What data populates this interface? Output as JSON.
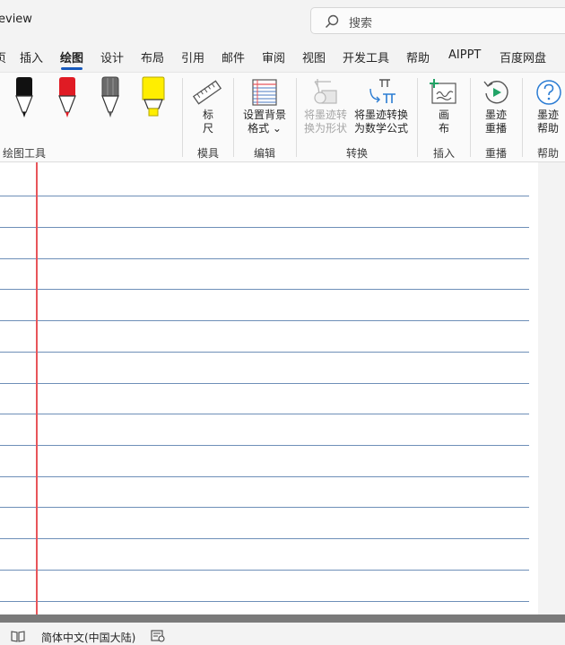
{
  "window": {
    "title_fragment": "eview"
  },
  "search": {
    "placeholder": "搜索"
  },
  "tabs": [
    {
      "label": "页"
    },
    {
      "label": "插入"
    },
    {
      "label": "绘图",
      "active": true
    },
    {
      "label": "设计"
    },
    {
      "label": "布局"
    },
    {
      "label": "引用"
    },
    {
      "label": "邮件"
    },
    {
      "label": "审阅"
    },
    {
      "label": "视图"
    },
    {
      "label": "开发工具"
    },
    {
      "label": "帮助"
    },
    {
      "label": "AIPPT"
    },
    {
      "label": "百度网盘"
    }
  ],
  "ribbon": {
    "pens": [
      {
        "name": "black-pen",
        "color": "#111111"
      },
      {
        "name": "red-pen",
        "color": "#e01b24"
      },
      {
        "name": "pencil",
        "color": "#6b6b6b"
      },
      {
        "name": "highlighter",
        "color": "#ffee00"
      }
    ],
    "groups": {
      "drawing_tools": "绘图工具",
      "stencils": "模具",
      "edit": "编辑",
      "convert": "转换",
      "insert": "插入",
      "replay": "重播",
      "help": "帮助"
    },
    "buttons": {
      "ruler": {
        "line1": "标",
        "line2": "尺"
      },
      "bg_format": {
        "line1": "设置背景",
        "line2": "格式 ⌄"
      },
      "ink_to_shape": {
        "line1": "将墨迹转",
        "line2": "换为形状",
        "disabled": true
      },
      "ink_to_math": {
        "line1": "将墨迹转换",
        "line2": "为数学公式"
      },
      "canvas": {
        "line1": "画",
        "line2": "布"
      },
      "ink_replay": {
        "line1": "墨迹",
        "line2": "重播"
      },
      "ink_help": {
        "line1": "墨迹",
        "line2": "帮助"
      }
    }
  },
  "statusbar": {
    "language": "简体中文(中国大陆)"
  },
  "colors": {
    "accent": "#185abd",
    "margin_line": "#e8555a",
    "rule_line": "#6e8fb8"
  }
}
